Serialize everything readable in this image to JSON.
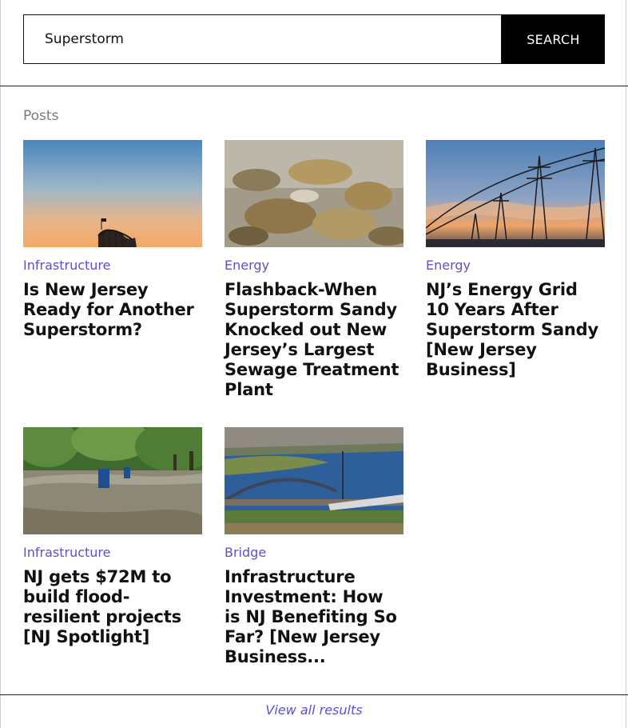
{
  "search": {
    "value": "Superstorm",
    "button_label": "SEARCH"
  },
  "section": {
    "label": "Posts"
  },
  "posts": [
    {
      "category": "Infrastructure",
      "title": "Is New Jersey Ready for Another Superstorm?",
      "image": "roller-coaster-sunset-image"
    },
    {
      "category": "Energy",
      "title": "Flashback-When Superstorm Sandy Knocked out New Jersey’s Largest Sewage Treatment Plant",
      "image": "sewage-water-image"
    },
    {
      "category": "Energy",
      "title": "NJ’s Energy Grid 10 Years After Superstorm Sandy [New Jersey Business]",
      "image": "power-lines-sunset-image"
    },
    {
      "category": "Infrastructure",
      "title": "NJ gets $72M to build flood-resilient projects [NJ Spotlight]",
      "image": "flooded-park-image"
    },
    {
      "category": "Bridge",
      "title": "Infrastructure Investment: How is NJ Benefiting So Far? [New Jersey Business...",
      "image": "rail-bridge-aerial-image"
    }
  ],
  "footer": {
    "view_all_label": "View all results"
  },
  "colors": {
    "accent": "#5b4fd6",
    "button_bg": "#000000",
    "muted_label": "#7a7a7a"
  }
}
